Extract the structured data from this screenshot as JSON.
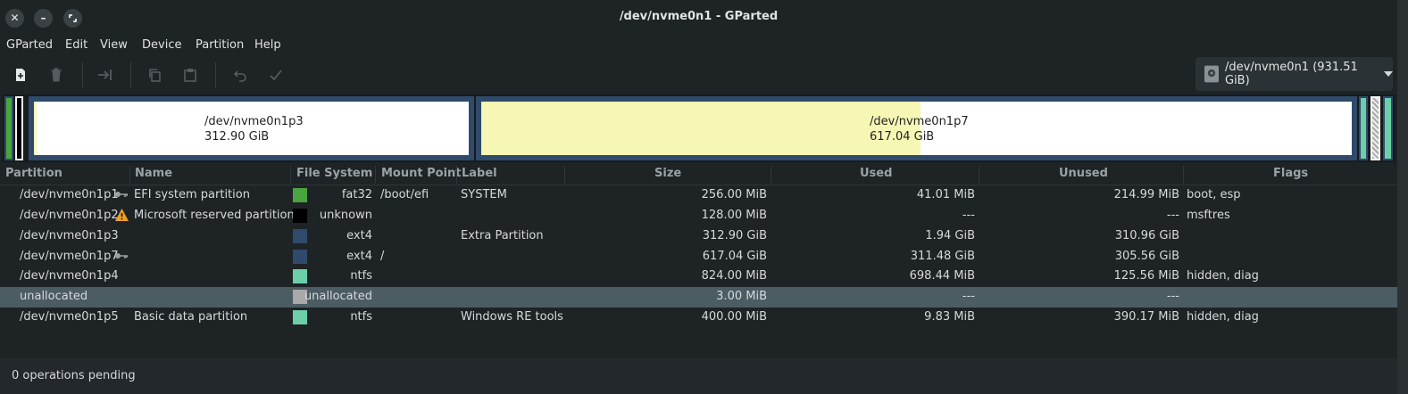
{
  "window": {
    "title": "/dev/nvme0n1 - GParted"
  },
  "menu": [
    "GParted",
    "Edit",
    "View",
    "Device",
    "Partition",
    "Help"
  ],
  "toolbar": {
    "buttons": [
      "new-icon",
      "delete-icon",
      "resize-move-icon",
      "copy-icon",
      "paste-icon",
      "undo-icon",
      "apply-icon"
    ]
  },
  "device_selector": {
    "label": "/dev/nvme0n1 (931.51 GiB)"
  },
  "map": {
    "p3": {
      "name": "/dev/nvme0n1p3",
      "size": "312.90 GiB",
      "used_fraction": 0.006
    },
    "p7": {
      "name": "/dev/nvme0n1p7",
      "size": "617.04 GiB",
      "used_fraction": 0.505
    }
  },
  "columns": [
    "Partition",
    "Name",
    "File System",
    "Mount Point",
    "Label",
    "Size",
    "Used",
    "Unused",
    "Flags"
  ],
  "colors": {
    "fat32": "#4aa43f",
    "unknown": "#000000",
    "ext4": "#2f4a6a",
    "ntfs": "#6ccfa9",
    "unallocated": "#a9a9a9"
  },
  "rows": [
    {
      "partition": "/dev/nvme0n1p1",
      "icon": "key-icon",
      "name": "EFI system partition",
      "fs": "fat32",
      "fs_color": "#4aa43f",
      "mount": "/boot/efi",
      "label": "SYSTEM",
      "size": "256.00 MiB",
      "used": "41.01 MiB",
      "unused": "214.99 MiB",
      "flags": "boot, esp"
    },
    {
      "partition": "/dev/nvme0n1p2",
      "icon": "warning-icon",
      "name": "Microsoft reserved partition",
      "fs": "unknown",
      "fs_color": "#000000",
      "mount": "",
      "label": "",
      "size": "128.00 MiB",
      "used": "---",
      "unused": "---",
      "flags": "msftres"
    },
    {
      "partition": "/dev/nvme0n1p3",
      "icon": "",
      "name": "",
      "fs": "ext4",
      "fs_color": "#2f4a6a",
      "mount": "",
      "label": "Extra Partition",
      "size": "312.90 GiB",
      "used": "1.94 GiB",
      "unused": "310.96 GiB",
      "flags": ""
    },
    {
      "partition": "/dev/nvme0n1p7",
      "icon": "key-icon",
      "name": "",
      "fs": "ext4",
      "fs_color": "#2f4a6a",
      "mount": "/",
      "label": "",
      "size": "617.04 GiB",
      "used": "311.48 GiB",
      "unused": "305.56 GiB",
      "flags": ""
    },
    {
      "partition": "/dev/nvme0n1p4",
      "icon": "",
      "name": "",
      "fs": "ntfs",
      "fs_color": "#6ccfa9",
      "mount": "",
      "label": "",
      "size": "824.00 MiB",
      "used": "698.44 MiB",
      "unused": "125.56 MiB",
      "flags": "hidden, diag"
    },
    {
      "partition": "unallocated",
      "icon": "",
      "name": "",
      "fs": "unallocated",
      "fs_color": "#a9a9a9",
      "mount": "",
      "label": "",
      "size": "3.00 MiB",
      "used": "---",
      "unused": "---",
      "flags": "",
      "selected": true
    },
    {
      "partition": "/dev/nvme0n1p5",
      "icon": "",
      "name": "Basic data partition",
      "fs": "ntfs",
      "fs_color": "#6ccfa9",
      "mount": "",
      "label": "Windows RE tools",
      "size": "400.00 MiB",
      "used": "9.83 MiB",
      "unused": "390.17 MiB",
      "flags": "hidden, diag"
    }
  ],
  "status": "0 operations pending"
}
